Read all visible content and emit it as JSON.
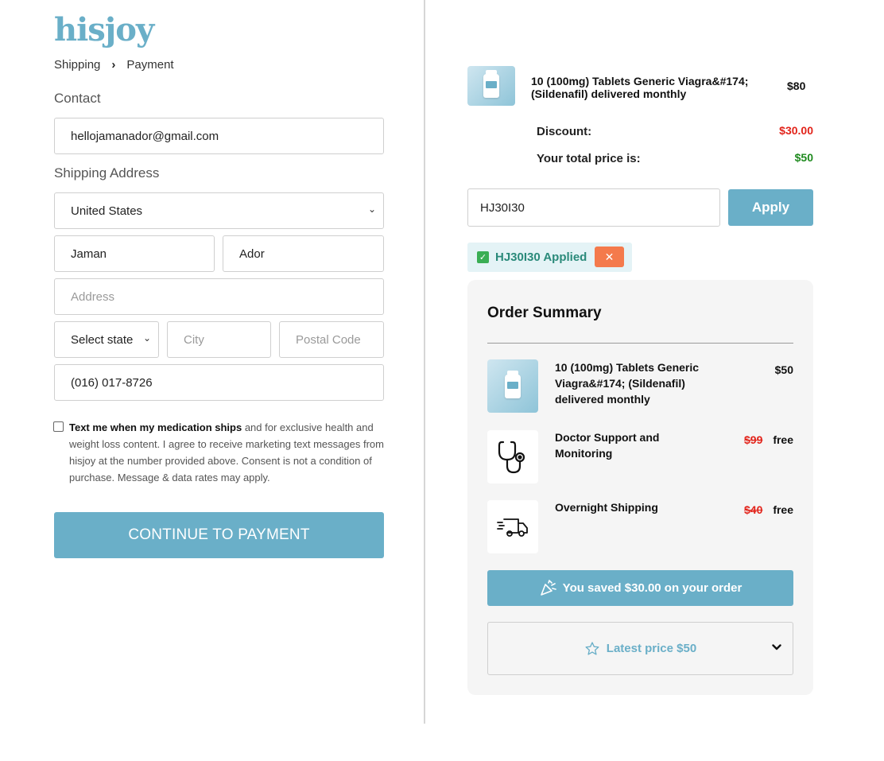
{
  "brand": {
    "logo": "hisjoy",
    "accent_color": "#6aafc8"
  },
  "breadcrumb": {
    "step1": "Shipping",
    "separator": "›",
    "step2": "Payment"
  },
  "contact": {
    "label": "Contact",
    "email": "hellojamanador@gmail.com"
  },
  "shipping": {
    "label": "Shipping Address",
    "country": "United States",
    "first_name": "Jaman",
    "last_name": "Ador",
    "address_placeholder": "Address",
    "state": "Select state",
    "city_placeholder": "City",
    "postal_placeholder": "Postal Code",
    "phone": "(016) 017-8726"
  },
  "consent": {
    "bold": "Text me when my medication ships",
    "text": " and for exclusive health and weight loss content. I agree to receive marketing text messages from hisjoy at the number provided above. Consent is not a condition of purchase. Message & data rates may apply."
  },
  "continue_label": "CONTINUE TO PAYMENT",
  "cart": {
    "product_name": "10 (100mg) Tablets Generic Viagra&#174; (Sildenafil) delivered monthly",
    "product_price": "$80",
    "discount_label": "Discount:",
    "discount_value": "$30.00",
    "total_label": "Your total price is:",
    "total_value": "$50"
  },
  "coupon": {
    "code": "HJ30I30",
    "apply_label": "Apply",
    "applied_text": "HJ30I30 Applied",
    "remove_symbol": "✕"
  },
  "summary": {
    "title": "Order Summary",
    "items": [
      {
        "name": "10 (100mg) Tablets Generic Viagra&#174; (Sildenafil) delivered monthly",
        "price": "$50",
        "old_price": "",
        "icon": "product-bottle-icon"
      },
      {
        "name": "Doctor Support and Monitoring",
        "price": "free",
        "old_price": "$99",
        "icon": "stethoscope-icon"
      },
      {
        "name": "Overnight Shipping",
        "price": "free",
        "old_price": "$40",
        "icon": "delivery-truck-icon"
      }
    ],
    "saved_text": "You saved $30.00 on your order",
    "latest_price": "Latest price $50"
  }
}
